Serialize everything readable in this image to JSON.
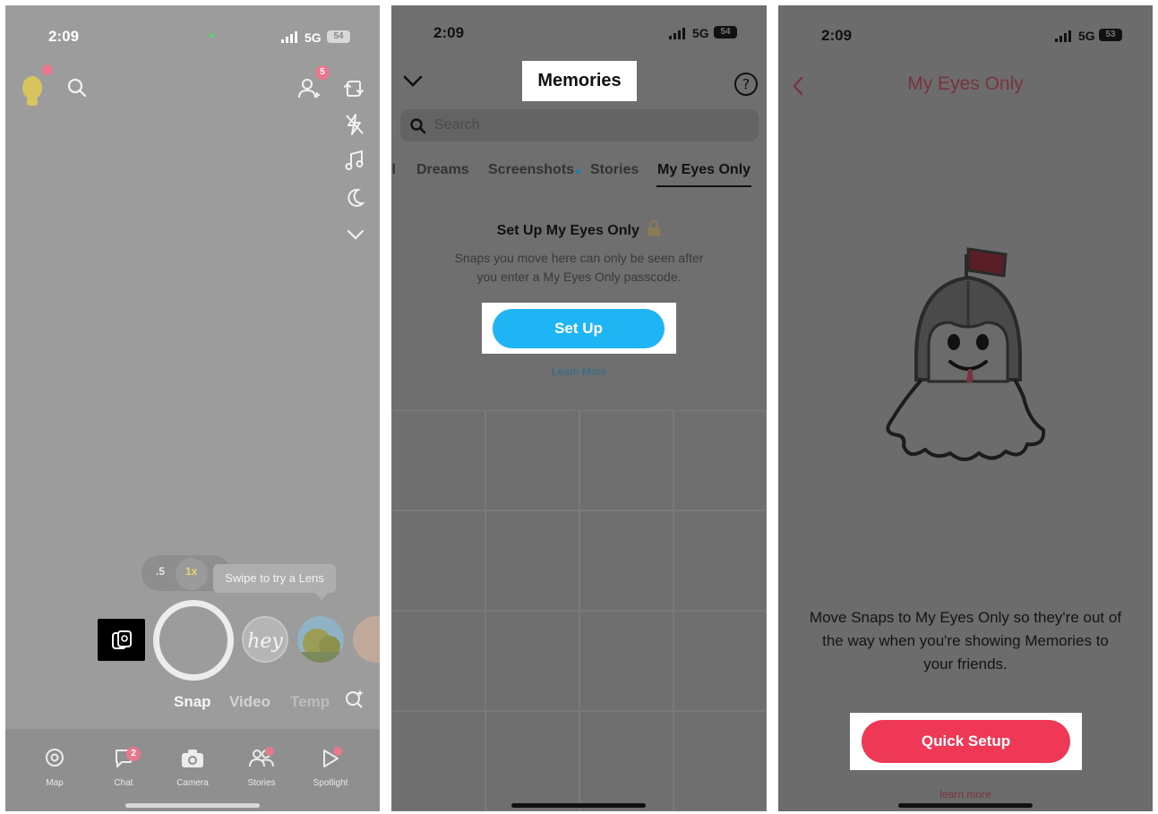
{
  "camera_screen": {
    "status": {
      "time": "2:09",
      "network": "5G",
      "battery": "54"
    },
    "friend_badge": "5",
    "zoom": {
      "options": [
        ".5",
        "1x"
      ]
    },
    "lens_tooltip": "Swipe to try a Lens",
    "modes": [
      "Snap",
      "Video",
      "Temp"
    ],
    "nav": [
      {
        "label": "Map",
        "icon": "map-pin-icon"
      },
      {
        "label": "Chat",
        "icon": "chat-icon",
        "badge": "2"
      },
      {
        "label": "Camera",
        "icon": "camera-icon"
      },
      {
        "label": "Stories",
        "icon": "stories-icon"
      },
      {
        "label": "Spotlight",
        "icon": "spotlight-icon"
      }
    ]
  },
  "memories_screen": {
    "status": {
      "time": "2:09",
      "network": "5G",
      "battery": "54"
    },
    "title": "Memories",
    "search_placeholder": "Search",
    "tabs": [
      "ll",
      "Dreams",
      "Screenshots",
      "Stories",
      "My Eyes Only"
    ],
    "active_tab": "My Eyes Only",
    "setup_title": "Set Up My Eyes Only",
    "setup_description_line1": "Snaps you move here can only be seen after",
    "setup_description_line2": "you enter a My Eyes Only passcode.",
    "setup_button": "Set Up",
    "learn_more": "Learn More"
  },
  "my_eyes_only_screen": {
    "status": {
      "time": "2:09",
      "network": "5G",
      "battery": "53"
    },
    "title": "My Eyes Only",
    "description_line1": "Move Snaps to My Eyes Only so they're out of",
    "description_line2": "the way when you're showing Memories to",
    "description_line3": "your friends.",
    "quick_setup_button": "Quick Setup",
    "learn_more": "learn more"
  },
  "colors": {
    "setup_blue": "#1fb5f5",
    "quick_setup_red": "#ef3856",
    "badge_pink": "#e8788c"
  }
}
